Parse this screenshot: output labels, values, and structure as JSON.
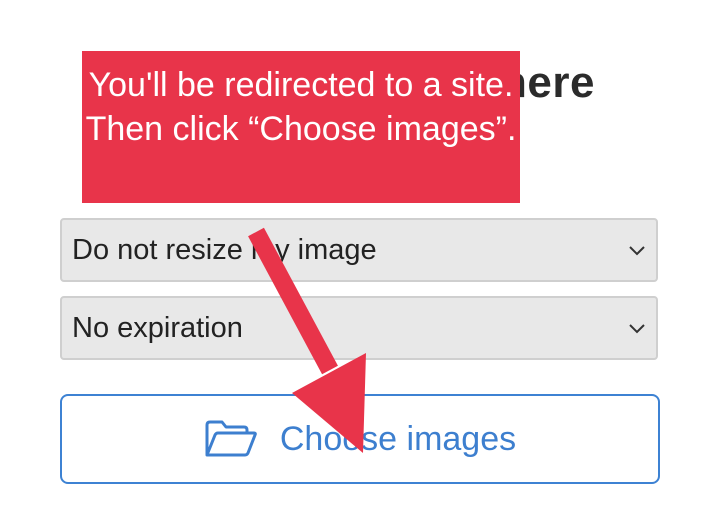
{
  "heading": {
    "visible_fragment": "here"
  },
  "form": {
    "resize_select": {
      "selected": "Do not resize my image"
    },
    "expiration_select": {
      "selected": "No expiration"
    },
    "choose_button_label": "Choose images"
  },
  "callout": {
    "text": "You'll be redirected to a site. Then click “Choose images”."
  },
  "icons": {
    "folder": "folder-open-icon",
    "chevron": "chevron-down-icon",
    "arrow": "red-arrow-annotation"
  },
  "colors": {
    "callout_bg": "#e8344a",
    "arrow": "#e8344a",
    "button_accent": "#3d82d3",
    "select_bg": "#e8e8e8"
  }
}
